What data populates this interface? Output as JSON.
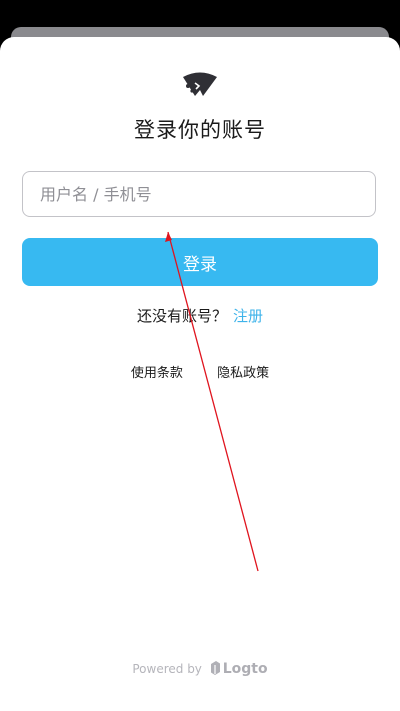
{
  "title": "登录你的账号",
  "identifier_input": {
    "value": "",
    "placeholder": "用户名 / 手机号"
  },
  "login_button": "登录",
  "signup": {
    "prompt": "还没有账号？",
    "link": "注册"
  },
  "legal": {
    "terms": "使用条款",
    "privacy": "隐私政策"
  },
  "footer": {
    "powered_by": "Powered by",
    "brand": "Logto"
  },
  "colors": {
    "accent": "#37b9f1",
    "link": "#3eb3ea",
    "annotation": "#e0141e"
  },
  "icons": {
    "logo": "app-logo-icon",
    "brand": "logto-mark-icon"
  }
}
